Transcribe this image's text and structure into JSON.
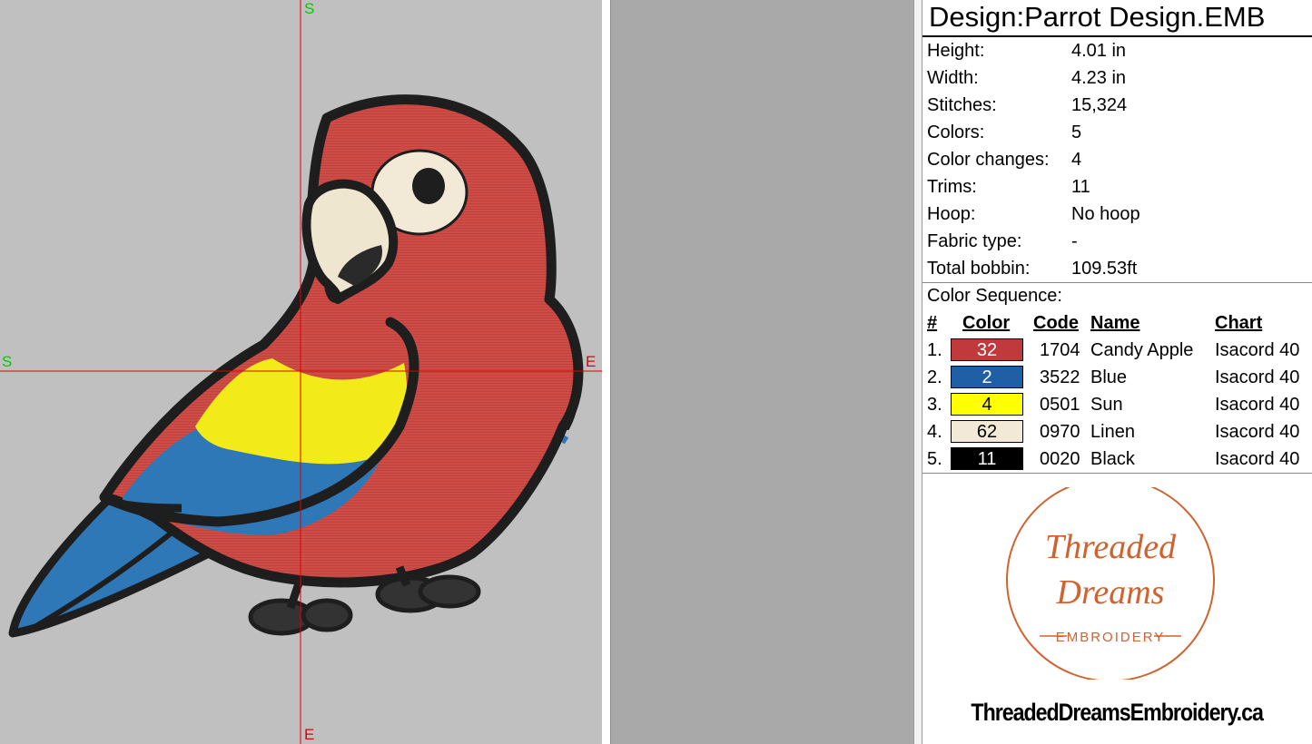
{
  "canvas": {
    "axis_labels": {
      "top": "S",
      "bottom": "E",
      "left": "S",
      "right": "E"
    },
    "colors": {
      "background": "#c0c0c0",
      "axis_line": "#e00000",
      "axis_label_start": "#00cc00",
      "axis_label_end": "#e00000"
    }
  },
  "design": {
    "title": "Design:Parrot Design.EMB",
    "properties": [
      {
        "label": "Height:",
        "value": "4.01 in"
      },
      {
        "label": "Width:",
        "value": "4.23 in"
      },
      {
        "label": "Stitches:",
        "value": "15,324"
      },
      {
        "label": "Colors:",
        "value": "5"
      },
      {
        "label": "Color changes:",
        "value": "4"
      },
      {
        "label": "Trims:",
        "value": "11"
      },
      {
        "label": "Hoop:",
        "value": "No hoop"
      },
      {
        "label": "Fabric type:",
        "value": "-"
      },
      {
        "label": "Total bobbin:",
        "value": "109.53ft"
      }
    ]
  },
  "color_sequence": {
    "title": "Color Sequence:",
    "headers": {
      "index": "#",
      "color": "Color",
      "code": "Code",
      "name": "Name",
      "chart": "Chart"
    },
    "rows": [
      {
        "index": "1.",
        "swatch_label": "32",
        "swatch_color": "#c0393b",
        "swatch_text_color": "#ffffff",
        "code": "1704",
        "name": "Candy Apple",
        "chart": "Isacord 40"
      },
      {
        "index": "2.",
        "swatch_label": "2",
        "swatch_color": "#1f5fa6",
        "swatch_text_color": "#ffffff",
        "code": "3522",
        "name": "Blue",
        "chart": "Isacord 40"
      },
      {
        "index": "3.",
        "swatch_label": "4",
        "swatch_color": "#ffff00",
        "swatch_text_color": "#000000",
        "code": "0501",
        "name": "Sun",
        "chart": "Isacord 40"
      },
      {
        "index": "4.",
        "swatch_label": "62",
        "swatch_color": "#f2ead6",
        "swatch_text_color": "#000000",
        "code": "0970",
        "name": "Linen",
        "chart": "Isacord 40"
      },
      {
        "index": "5.",
        "swatch_label": "11",
        "swatch_color": "#000000",
        "swatch_text_color": "#ffffff",
        "code": "0020",
        "name": "Black",
        "chart": "Isacord 40"
      }
    ]
  },
  "brand": {
    "logo_line1": "Threaded",
    "logo_line2": "Dreams",
    "logo_line3": "EMBROIDERY",
    "logo_color": "#d0622f",
    "website": "ThreadedDreamsEmbroidery.ca"
  }
}
